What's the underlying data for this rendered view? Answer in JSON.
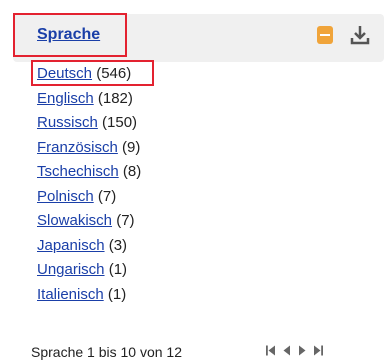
{
  "facet": {
    "title": "Sprache",
    "items": [
      {
        "label": "Deutsch",
        "count": "(546)"
      },
      {
        "label": "Englisch",
        "count": "(182)"
      },
      {
        "label": "Russisch",
        "count": "(150)"
      },
      {
        "label": "Französisch",
        "count": "(9)"
      },
      {
        "label": "Tschechisch",
        "count": "(8)"
      },
      {
        "label": "Polnisch",
        "count": "(7)"
      },
      {
        "label": "Slowakisch",
        "count": "(7)"
      },
      {
        "label": "Japanisch",
        "count": "(3)"
      },
      {
        "label": "Ungarisch",
        "count": "(1)"
      },
      {
        "label": "Italienisch",
        "count": "(1)"
      }
    ],
    "pagination_text": "Sprache 1 bis 10 von 12"
  },
  "icons": {
    "collapse": "minus-square-icon",
    "download": "download-icon",
    "pager": [
      "first-page-icon",
      "prev-page-icon",
      "next-page-icon",
      "last-page-icon"
    ]
  },
  "colors": {
    "link": "#1a3fa8",
    "highlight_border": "#e32230",
    "collapse_button": "#f0a43a",
    "header_background": "#f0f0f0"
  }
}
